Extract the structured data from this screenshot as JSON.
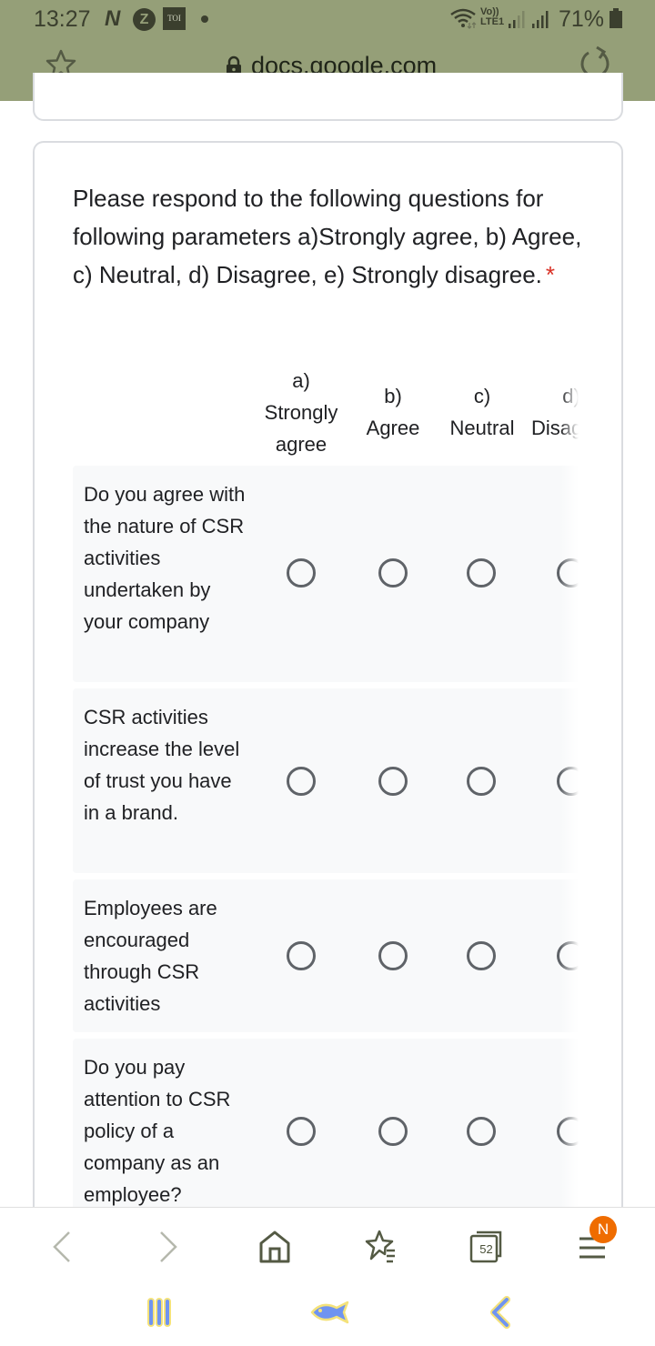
{
  "status_bar": {
    "time": "13:27",
    "notification_icons": [
      "n-icon",
      "z-icon",
      "toi-icon",
      "dot"
    ],
    "toi_label": "TOI",
    "z_label": "Z",
    "n_label": "N",
    "network_label_top": "Vo))",
    "network_label_bottom": "LTE1",
    "battery_percent": "71%"
  },
  "browser": {
    "url": "docs.google.com",
    "bookmark_icon": "star-icon",
    "reload_icon": "reload-icon",
    "lock_icon": "lock-icon"
  },
  "form": {
    "question": "Please respond to the following questions for following parameters a)Strongly agree, b) Agree, c) Neutral, d) Disagree, e) Strongly disagree.",
    "required_mark": "*",
    "columns": [
      {
        "line1": "a)",
        "line2": "Strongly",
        "line3": "agree"
      },
      {
        "line1": "b)",
        "line2": "Agree"
      },
      {
        "line1": "c)",
        "line2": "Neutral"
      },
      {
        "line1": "d)",
        "line2": "Disagree"
      }
    ],
    "rows": [
      {
        "label": "Do you agree with the nature of CSR activities undertaken by your company",
        "selected": null
      },
      {
        "label": "CSR activities increase the level of trust you have in a brand.",
        "selected": null
      },
      {
        "label": "Employees are encouraged through CSR activities",
        "selected": null
      },
      {
        "label": "Do you pay attention to CSR policy of a company as an employee?",
        "selected": null
      }
    ]
  },
  "bottom_nav": {
    "items": [
      "back-icon",
      "forward-icon",
      "home-icon",
      "bookmarks-icon",
      "tabs-icon",
      "menu-icon"
    ],
    "tabs_count": "52",
    "menu_badge": "N"
  },
  "system_nav": {
    "items": [
      "recents-icon",
      "home-fish-icon",
      "back-icon"
    ]
  },
  "colors": {
    "toolbar_bg": "#959f78",
    "row_bg": "#f8f9fa",
    "required": "#d93025",
    "radio": "#5f6368",
    "badge": "#ef6c00",
    "sys_nav_fill": "#6f94f0",
    "sys_nav_outline": "#f4e27a"
  }
}
